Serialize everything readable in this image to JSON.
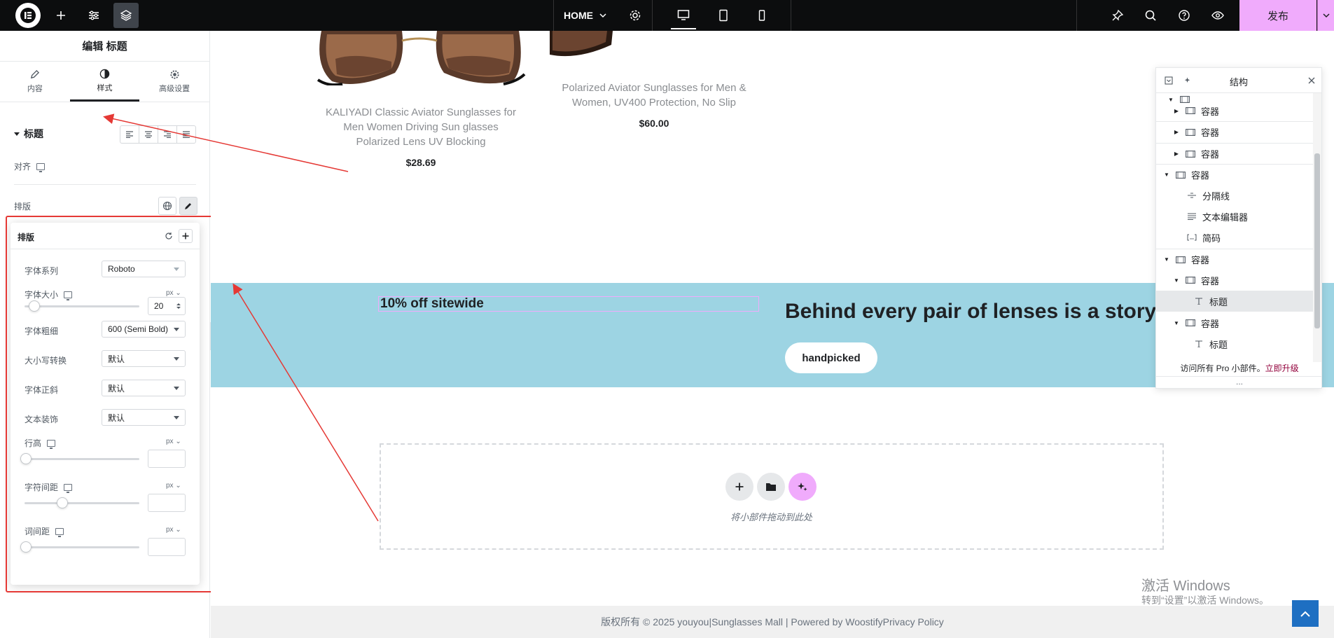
{
  "topbar": {
    "page_name": "HOME",
    "publish_label": "发布"
  },
  "panel": {
    "title": "编辑 标题",
    "tabs": [
      {
        "label": "内容",
        "icon": "pencil-icon"
      },
      {
        "label": "样式",
        "icon": "contrast-icon"
      },
      {
        "label": "高级设置",
        "icon": "gear-icon"
      }
    ],
    "active_tab": "样式",
    "section": "标题",
    "align_label": "对齐",
    "typography_label": "排版"
  },
  "typography": {
    "title": "排版",
    "font_family_label": "字体系列",
    "font_family": "Roboto",
    "font_size_label": "字体大小",
    "font_size": "20",
    "font_weight_label": "字体粗细",
    "font_weight": "600 (Semi Bold)",
    "transform_label": "大小写转换",
    "transform": "默认",
    "style_label": "字体正斜",
    "style": "默认",
    "decoration_label": "文本装饰",
    "decoration": "默认",
    "line_height_label": "行高",
    "letter_spacing_label": "字符间距",
    "word_spacing_label": "词间距",
    "unit": "px"
  },
  "canvas": {
    "product1_title": "KALIYADI Classic Aviator Sunglasses for Men Women Driving Sun glasses Polarized Lens UV Blocking",
    "product1_price": "$28.69",
    "product2_title": "Polarized Aviator Sunglasses for Men & Women, UV400 Protection, No Slip",
    "product2_price": "$60.00",
    "banner_small": "10% off sitewide",
    "banner_big": "Behind every pair of lenses is a story",
    "banner_button": "handpicked",
    "dropzone_text": "将小部件拖动到此处",
    "footer": "版权所有 © 2025 youyou|Sunglasses Mall | Powered by WoostifyPrivacy Policy",
    "watermark_line1": "激活 Windows",
    "watermark_line2": "转到“设置”以激活 Windows。"
  },
  "structure": {
    "title": "结构",
    "rows": [
      {
        "label": "容器"
      },
      {
        "label": "容器"
      },
      {
        "label": "容器"
      },
      {
        "label": "容器"
      },
      {
        "label": "分隔线"
      },
      {
        "label": "文本编辑器"
      },
      {
        "label": "简码"
      },
      {
        "label": "容器"
      },
      {
        "label": "容器"
      },
      {
        "label": "标题"
      },
      {
        "label": "容器"
      },
      {
        "label": "标题"
      }
    ],
    "footer_text": "访问所有 Pro 小部件。",
    "footer_link": "立即升级",
    "dots": "..."
  },
  "colors": {
    "accent": "#f0abfc",
    "banner": "#9dd4e3",
    "annotation": "#e53935"
  }
}
